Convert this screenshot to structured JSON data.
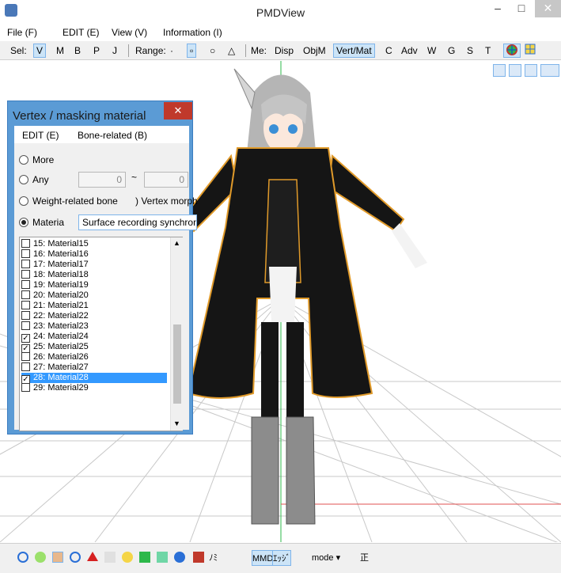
{
  "window": {
    "title": "PMDView",
    "min": "–",
    "max": "□",
    "close": "✕"
  },
  "menu": [
    "File (F)",
    "EDIT (E)",
    "View (V)",
    "Information (I)"
  ],
  "toolbar": {
    "sel_label": "Sel:",
    "sel_items": [
      "V",
      "M",
      "B",
      "P",
      "J"
    ],
    "range_label": "Range:",
    "range_items": [
      "·",
      "▫",
      "○",
      "△"
    ],
    "me_label": "Me:",
    "me_items": [
      "Disp",
      "ObjM",
      "Vert/Mat",
      "C",
      "Adv",
      "W",
      "G",
      "S",
      "T"
    ],
    "selected": [
      "V",
      "Vert/Mat"
    ]
  },
  "dialog": {
    "title": "Vertex / masking material",
    "close": "✕",
    "menu": [
      "EDIT (E)",
      "Bone-related (B)"
    ],
    "options": {
      "more": "More",
      "any": "Any",
      "any_from": "0",
      "tilde": "~",
      "any_to": "0",
      "weight": "Weight-related bone",
      "vertex_morph": "Vertex morph",
      "material": "Materia",
      "combo": "Surface recording synchroniz"
    },
    "materials": [
      {
        "label": "15: Material15",
        "checked": false
      },
      {
        "label": "16: Material16",
        "checked": false
      },
      {
        "label": "17: Material17",
        "checked": false
      },
      {
        "label": "18: Material18",
        "checked": false
      },
      {
        "label": "19: Material19",
        "checked": false
      },
      {
        "label": "20: Material20",
        "checked": false
      },
      {
        "label": "21: Material21",
        "checked": false
      },
      {
        "label": "22: Material22",
        "checked": false
      },
      {
        "label": "23: Material23",
        "checked": false
      },
      {
        "label": "24: Material24",
        "checked": true
      },
      {
        "label": "25: Material25",
        "checked": true
      },
      {
        "label": "26: Material26",
        "checked": false
      },
      {
        "label": "27: Material27",
        "checked": false
      },
      {
        "label": "28: Material28",
        "checked": true,
        "selected": true
      },
      {
        "label": "29: Material29",
        "checked": false
      }
    ]
  },
  "statusbar": {
    "nomi": "ﾉﾐ",
    "mmd": "MMD",
    "edge": "ｴｯｼﾞ",
    "mode": "mode",
    "kanji": "正"
  },
  "colors": {
    "accent": "#5b9bd5",
    "selection": "#3399ff",
    "coat": "#151515",
    "trim": "#e09a2a"
  }
}
